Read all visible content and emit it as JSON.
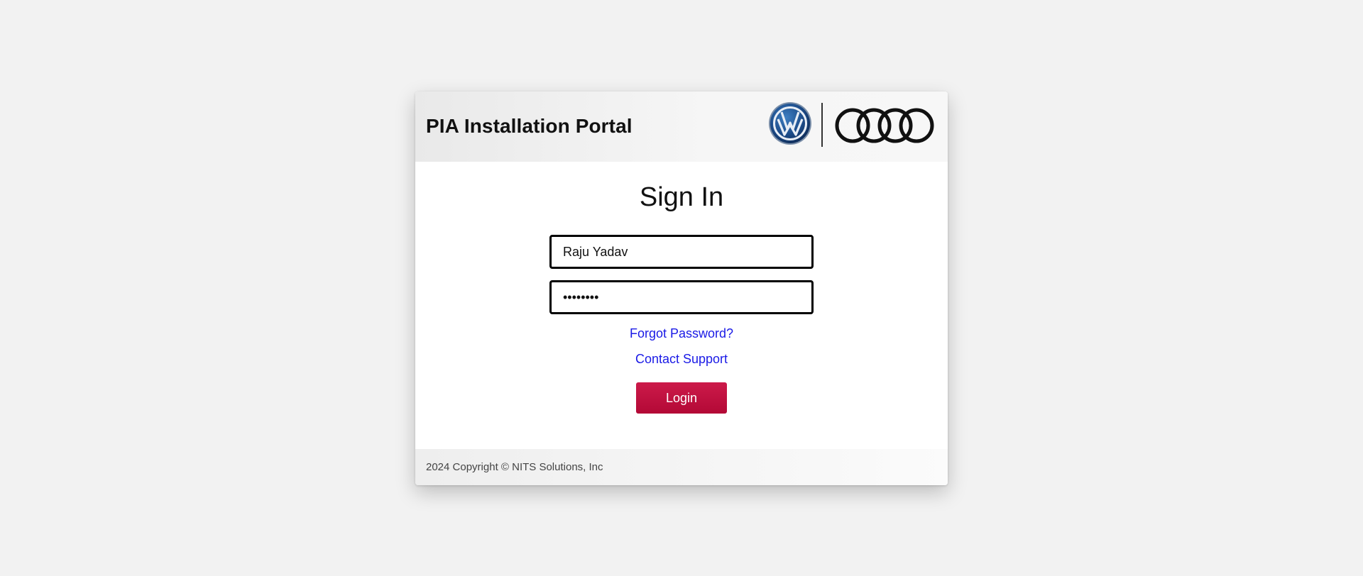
{
  "header": {
    "title": "PIA Installation Portal",
    "logos": [
      "vw-logo",
      "audi-logo"
    ]
  },
  "form": {
    "heading": "Sign In",
    "username_value": "Raju Yadav",
    "password_value": "••••••••",
    "forgot_password_label": "Forgot Password?",
    "contact_support_label": "Contact Support",
    "login_label": "Login"
  },
  "footer": {
    "copyright": "2024 Copyright © NITS Solutions, Inc"
  },
  "colors": {
    "background": "#f2f2f2",
    "link": "#1a1ae6",
    "login_button": "#c0103f"
  }
}
